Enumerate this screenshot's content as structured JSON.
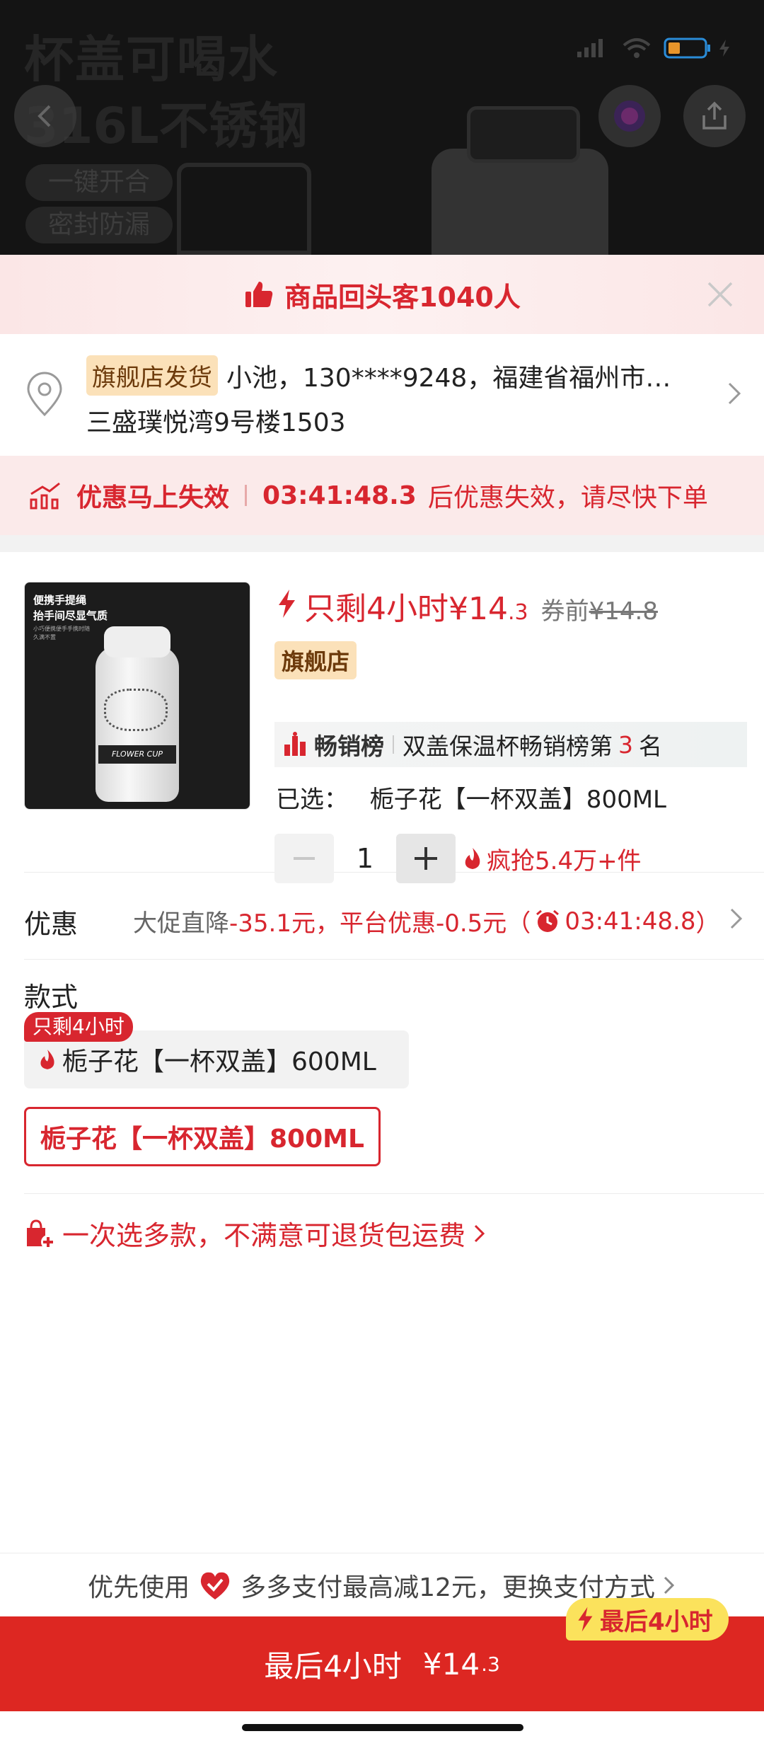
{
  "hero": {
    "ghost_title_1": "杯盖可喝水",
    "ghost_title_2": "316L不锈钢",
    "pills": [
      "一键开合",
      "密封防漏"
    ]
  },
  "banner": {
    "text": "商品回头客1040人"
  },
  "address": {
    "tag": "旗舰店发货",
    "line1": "小池，130****9248，福建省福州市…",
    "line2": "三盛璞悦湾9号楼1503"
  },
  "countdown": {
    "title": "优惠马上失效",
    "time": "03:41:48.3",
    "after": "后优惠失效，请尽快下单"
  },
  "product": {
    "thumb_text": [
      "便携手提绳",
      "抬手间尽显气质",
      "小巧便携便手手携时随",
      "久满不置"
    ],
    "thumb_band": "FLOWER CUP",
    "price_prefix": "只剩4小时¥14",
    "price_decimal": ".3",
    "pre_label": "券前",
    "orig_price": "¥14.8",
    "store_tag": "旗舰店",
    "rank_label": "畅销榜",
    "rank_text_a": "双盖保温杯畅销榜第",
    "rank_num": "3",
    "rank_text_b": "名",
    "selected_label": "已选：",
    "selected_value": "栀子花【一杯双盖】800ML",
    "qty": "1",
    "hot_text": "疯抢5.4万+件"
  },
  "discount": {
    "label": "优惠",
    "part1": "大促直降",
    "part2": "-35.1元，平台优惠-0.5元（",
    "time": "03:41:48.8",
    "part3": "）"
  },
  "styles": {
    "label": "款式",
    "badge": "只剩4小时",
    "option1": "栀子花【一杯双盖】600ML",
    "option2": "栀子花【一杯双盖】800ML"
  },
  "multi": {
    "text": "一次选多款，不满意可退货包运费"
  },
  "payline": {
    "prefix": "优先使用",
    "text": "多多支付最高减12元，更换支付方式"
  },
  "buy": {
    "label": "最后4小时",
    "price": "¥14",
    "price_decimal": ".3",
    "badge": "最后4小时"
  },
  "colors": {
    "accent": "#d8262f",
    "buy_bg": "#dd2722",
    "badge_yellow": "#fbe25c"
  }
}
